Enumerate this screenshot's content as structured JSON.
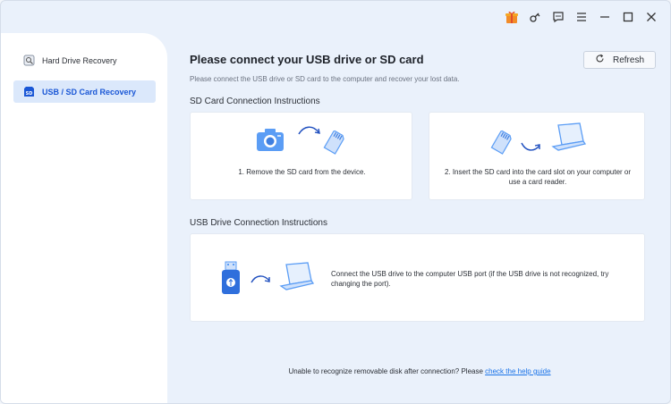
{
  "sidebar": {
    "items": [
      {
        "label": "Hard Drive Recovery",
        "icon": "hard-drive-icon",
        "active": false
      },
      {
        "label": "USB / SD Card Recovery",
        "icon": "sd-card-icon",
        "active": true
      }
    ]
  },
  "titlebar": {
    "icons": [
      "gift-icon",
      "key-icon",
      "feedback-icon",
      "menu-icon",
      "minimize-icon",
      "maximize-icon",
      "close-icon"
    ]
  },
  "main": {
    "title": "Please connect your USB drive or SD card",
    "subtitle": "Please connect the USB drive or SD card to the computer and recover your lost data.",
    "refresh_label": "Refresh",
    "sd_section_title": "SD Card Connection Instructions",
    "sd_step1": "1. Remove the SD card from the device.",
    "sd_step2_line1": "2. Insert the SD card into the card slot on your computer or",
    "sd_step2_line2": "use a card reader.",
    "usb_section_title": "USB Drive Connection Instructions",
    "usb_step_line1": "Connect the USB drive to the computer USB port (if the USB drive is not recognized, try",
    "usb_step_line2": "changing the port).",
    "help_text": "Unable to recognize removable disk after connection? Please",
    "help_link": "check the help guide"
  },
  "colors": {
    "accent": "#1a57d6",
    "active_bg": "#dbe8fb",
    "link": "#1a73e8",
    "illustration": "#5b9df5"
  }
}
